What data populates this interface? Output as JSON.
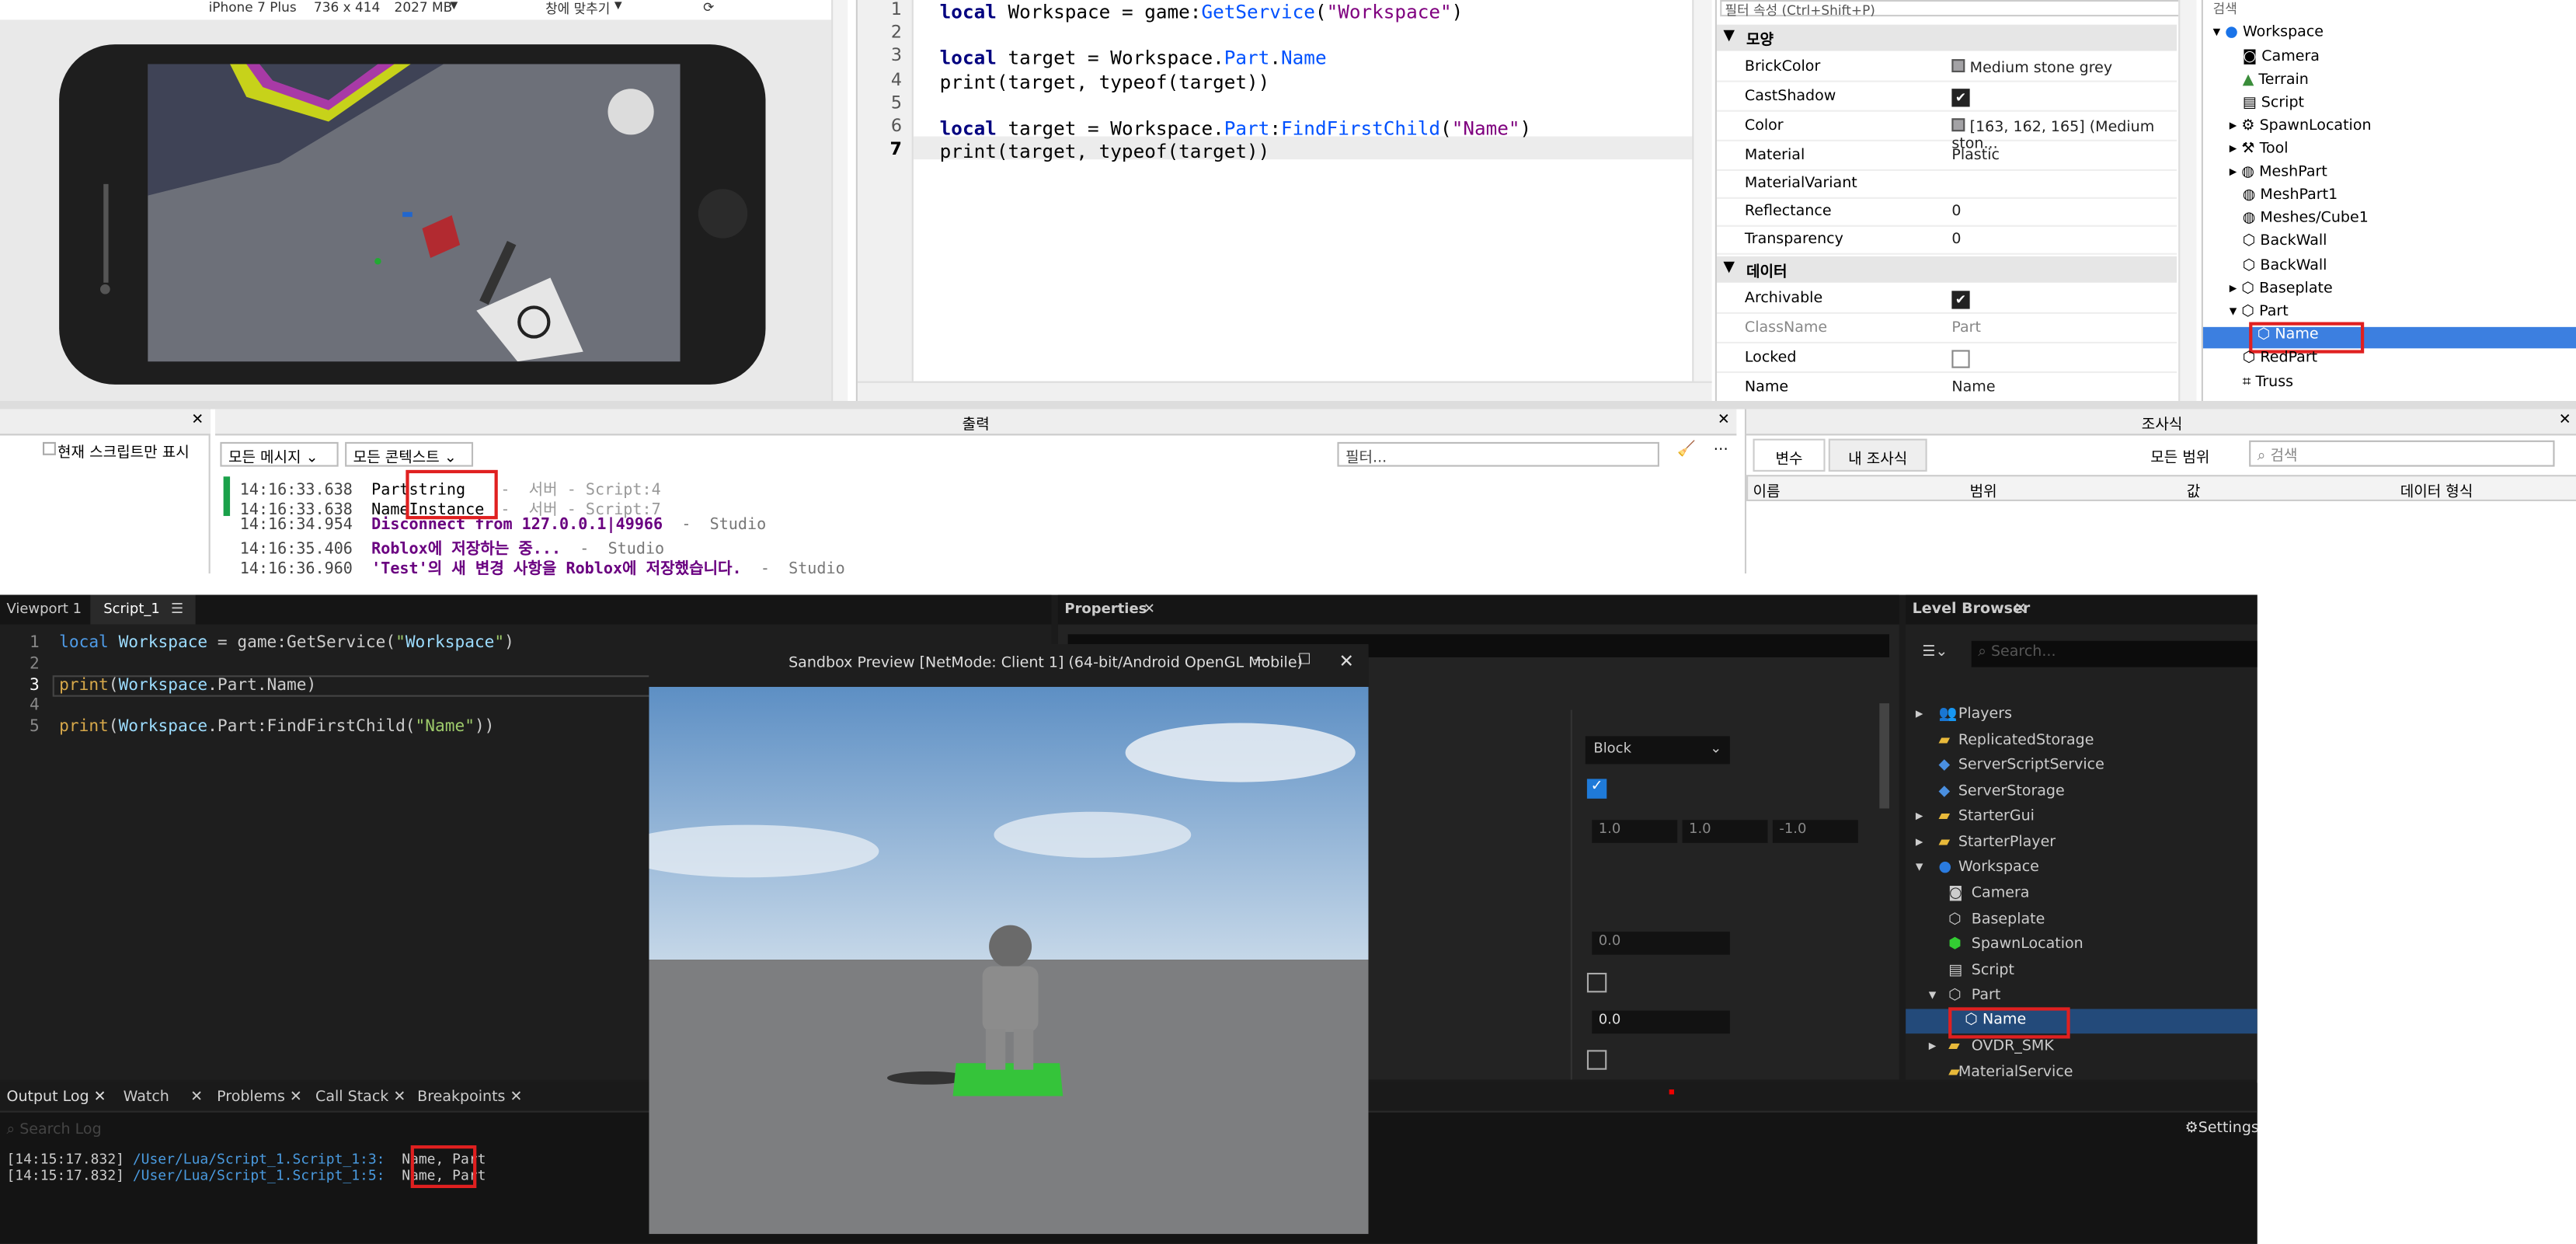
{
  "device_bar": {
    "device": "iPhone 7 Plus",
    "resolution": "736 x 414",
    "memory": "2027 MB",
    "fit": "창에 맞추기"
  },
  "code_top": {
    "line_numbers": [
      "1",
      "2",
      "3",
      "4",
      "5",
      "6",
      "7"
    ],
    "lines": [
      "local Workspace = game:GetService(\"Workspace\")",
      "",
      "local target = Workspace.Part.Name",
      "print(target, typeof(target))",
      "",
      "local target = Workspace.Part:FindFirstChild(\"Name\")",
      "print(target, typeof(target))"
    ]
  },
  "properties_top": {
    "filter_placeholder": "필터 속성 (Ctrl+Shift+P)",
    "sections": {
      "appearance": "모양",
      "data": "데이터"
    },
    "rows": [
      {
        "key": "BrickColor",
        "value": "Medium stone grey"
      },
      {
        "key": "CastShadow",
        "value": "✔"
      },
      {
        "key": "Color",
        "value": "[163, 162, 165] (Medium ston..."
      },
      {
        "key": "Material",
        "value": "Plastic"
      },
      {
        "key": "MaterialVariant",
        "value": ""
      },
      {
        "key": "Reflectance",
        "value": "0"
      },
      {
        "key": "Transparency",
        "value": "0"
      },
      {
        "key": "Archivable",
        "value": "✔"
      },
      {
        "key": "ClassName",
        "value": "Part"
      },
      {
        "key": "Locked",
        "value": ""
      },
      {
        "key": "Name",
        "value": "Name"
      }
    ]
  },
  "explorer_top": {
    "search_placeholder": "검색",
    "items": [
      "Workspace",
      "Camera",
      "Terrain",
      "Script",
      "SpawnLocation",
      "Tool",
      "MeshPart",
      "MeshPart1",
      "Meshes/Cube1",
      "BackWall",
      "BackWall",
      "Baseplate",
      "Part",
      "Name",
      "RedPart",
      "Truss"
    ]
  },
  "left_panel": {
    "checkbox_label": "현재 스크립트만 표시"
  },
  "output_top": {
    "title": "출력",
    "filter_all_messages": "모든 메시지",
    "filter_all_contexts": "모든 콘텍스트",
    "filter_placeholder": "필터...",
    "lines": [
      {
        "time": "14:16:33.638",
        "text": "Part",
        "extra": "string",
        "src": " -  서버 - Script:4"
      },
      {
        "time": "14:16:33.638",
        "text": "Name",
        "extra": "Instance",
        "src": " -  서버 - Script:7"
      },
      {
        "time": "14:16:34.954",
        "text": "Disconnect from 127.0.0.1|49966",
        "extra": "",
        "src": "  -  Studio"
      },
      {
        "time": "14:16:35.406",
        "text": "Roblox에 저장하는 중...",
        "extra": "",
        "src": "  -  Studio"
      },
      {
        "time": "14:16:36.960",
        "text": "'Test'의 새 변경 사항을 Roblox에 저장했습니다.",
        "extra": "",
        "src": "  -  Studio"
      }
    ]
  },
  "inspector": {
    "title": "조사식",
    "tabs": [
      "변수",
      "내 조사식"
    ],
    "scope": "모든 범위",
    "search_placeholder": "검색",
    "columns": [
      "이름",
      "범위",
      "값",
      "데이터 형식"
    ]
  },
  "ue": {
    "tabs": [
      "Viewport 1",
      "Script_1"
    ],
    "line_numbers": [
      "1",
      "2",
      "3",
      "4",
      "5"
    ],
    "code": [
      "local Workspace = game:GetService(\"Workspace\")",
      "",
      "print(Workspace.Part.Name)",
      "",
      "print(Workspace.Part:FindFirstChild(\"Name\"))"
    ],
    "properties_title": "Properties",
    "block_value": "Block",
    "vec": [
      "1.0",
      "1.0",
      "-1.0"
    ],
    "zero1": "0.0",
    "zero2": "0.0",
    "level_title": "Level Browser",
    "level_search": "Search...",
    "level_items": [
      "Players",
      "ReplicatedStorage",
      "ServerScriptService",
      "ServerStorage",
      "StarterGui",
      "StarterPlayer",
      "Workspace",
      "Camera",
      "Baseplate",
      "SpawnLocation",
      "Script",
      "Part",
      "Name",
      "OVDR_SMK",
      "MaterialService"
    ],
    "log_tabs": [
      "Output Log",
      "Watch",
      "Problems",
      "Call Stack",
      "Breakpoints"
    ],
    "log_search": "Search Log",
    "settings": "Settings",
    "log_lines": [
      {
        "time": "[14:15:17.832]",
        "path": "/User/Lua/Script_1.Script_1:3:",
        "a": "Name,",
        "b": "Part"
      },
      {
        "time": "[14:15:17.832]",
        "path": "/User/Lua/Script_1.Script_1:5:",
        "a": "Name,",
        "b": "Part"
      }
    ],
    "sandbox_title": "Sandbox Preview [NetMode: Client 1]  (64-bit/Android OpenGL Mobile)"
  }
}
